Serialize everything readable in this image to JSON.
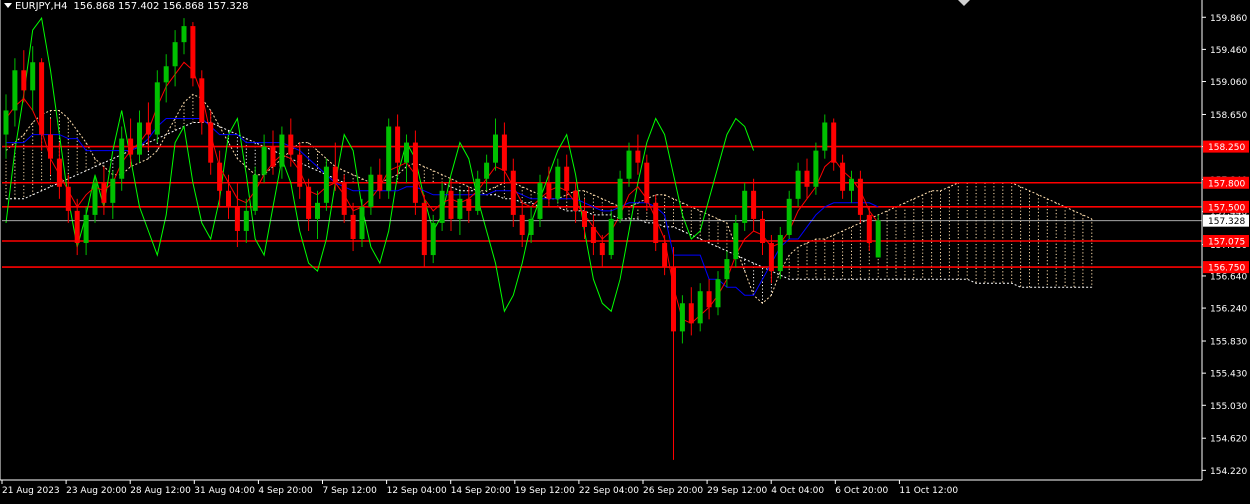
{
  "header": {
    "symbol": "EURJPY,H4",
    "ohlc": "156.868 157.402 156.868 157.328"
  },
  "colors": {
    "background": "#000000",
    "axis": "#ffffff",
    "bull": "#00c000",
    "bear": "#ff0000",
    "tenkan": "#ff0000",
    "kijun": "#0000ff",
    "chikou": "#00ff00",
    "cloud_up": "#ffdead",
    "cloud_down": "#ffffff",
    "level_line": "#ff0000",
    "level_label_bg": "#ff0000",
    "price_label_bg": "#ffffff"
  },
  "chart_data": {
    "type": "candlestick",
    "indicator": "ichimoku",
    "y_ticks": [
      "159.860",
      "159.460",
      "159.060",
      "158.650",
      "158.250",
      "157.840",
      "157.440",
      "157.030",
      "156.640",
      "156.240",
      "155.830",
      "155.430",
      "155.030",
      "154.620",
      "154.220"
    ],
    "x_ticks": [
      "21 Aug 2023",
      "23 Aug 20:00",
      "28 Aug 12:00",
      "31 Aug 04:00",
      "4 Sep 20:00",
      "7 Sep 12:00",
      "12 Sep 04:00",
      "14 Sep 20:00",
      "19 Sep 12:00",
      "22 Sep 04:00",
      "26 Sep 20:00",
      "29 Sep 12:00",
      "4 Oct 04:00",
      "6 Oct 20:00",
      "11 Oct 12:00"
    ],
    "ylim": [
      154.1,
      160.05
    ],
    "current_price": "157.328",
    "levels": [
      {
        "label": "158.250",
        "value": 158.25
      },
      {
        "label": "157.800",
        "value": 157.8
      },
      {
        "label": "157.500",
        "value": 157.5
      },
      {
        "label": "157.075",
        "value": 157.075
      },
      {
        "label": "156.750",
        "value": 156.75
      }
    ],
    "candles": [
      {
        "o": 158.4,
        "h": 158.9,
        "l": 158.1,
        "c": 158.7
      },
      {
        "o": 158.7,
        "h": 159.35,
        "l": 158.5,
        "c": 159.2
      },
      {
        "o": 159.2,
        "h": 159.45,
        "l": 158.8,
        "c": 158.95
      },
      {
        "o": 158.95,
        "h": 159.5,
        "l": 158.7,
        "c": 159.3
      },
      {
        "o": 159.3,
        "h": 159.35,
        "l": 158.2,
        "c": 158.4
      },
      {
        "o": 158.4,
        "h": 158.6,
        "l": 157.9,
        "c": 158.1
      },
      {
        "o": 158.1,
        "h": 158.3,
        "l": 157.6,
        "c": 157.75
      },
      {
        "o": 157.75,
        "h": 157.9,
        "l": 157.3,
        "c": 157.45
      },
      {
        "o": 157.45,
        "h": 157.6,
        "l": 156.9,
        "c": 157.05
      },
      {
        "o": 157.05,
        "h": 157.5,
        "l": 156.9,
        "c": 157.4
      },
      {
        "o": 157.4,
        "h": 157.9,
        "l": 157.3,
        "c": 157.8
      },
      {
        "o": 157.8,
        "h": 158.0,
        "l": 157.4,
        "c": 157.55
      },
      {
        "o": 157.55,
        "h": 157.95,
        "l": 157.35,
        "c": 157.85
      },
      {
        "o": 157.85,
        "h": 158.5,
        "l": 157.7,
        "c": 158.35
      },
      {
        "o": 158.35,
        "h": 158.6,
        "l": 158.0,
        "c": 158.15
      },
      {
        "o": 158.15,
        "h": 158.7,
        "l": 158.05,
        "c": 158.55
      },
      {
        "o": 158.55,
        "h": 158.8,
        "l": 158.2,
        "c": 158.4
      },
      {
        "o": 158.4,
        "h": 159.2,
        "l": 158.3,
        "c": 159.05
      },
      {
        "o": 159.05,
        "h": 159.4,
        "l": 158.8,
        "c": 159.25
      },
      {
        "o": 159.25,
        "h": 159.7,
        "l": 159.0,
        "c": 159.55
      },
      {
        "o": 159.55,
        "h": 159.85,
        "l": 159.4,
        "c": 159.75
      },
      {
        "o": 159.75,
        "h": 159.8,
        "l": 159.0,
        "c": 159.1
      },
      {
        "o": 159.1,
        "h": 159.2,
        "l": 158.4,
        "c": 158.55
      },
      {
        "o": 158.55,
        "h": 158.7,
        "l": 157.9,
        "c": 158.05
      },
      {
        "o": 158.05,
        "h": 158.2,
        "l": 157.5,
        "c": 157.7
      },
      {
        "o": 157.7,
        "h": 157.9,
        "l": 157.35,
        "c": 157.5
      },
      {
        "o": 157.5,
        "h": 157.8,
        "l": 157.0,
        "c": 157.2
      },
      {
        "o": 157.2,
        "h": 157.6,
        "l": 157.05,
        "c": 157.45
      },
      {
        "o": 157.45,
        "h": 158.0,
        "l": 157.4,
        "c": 157.9
      },
      {
        "o": 157.9,
        "h": 158.4,
        "l": 157.8,
        "c": 158.25
      },
      {
        "o": 158.25,
        "h": 158.45,
        "l": 157.9,
        "c": 158.0
      },
      {
        "o": 158.0,
        "h": 158.5,
        "l": 157.85,
        "c": 158.4
      },
      {
        "o": 158.4,
        "h": 158.6,
        "l": 158.0,
        "c": 158.15
      },
      {
        "o": 158.15,
        "h": 158.3,
        "l": 157.6,
        "c": 157.75
      },
      {
        "o": 157.75,
        "h": 157.85,
        "l": 157.2,
        "c": 157.35
      },
      {
        "o": 157.35,
        "h": 157.7,
        "l": 157.1,
        "c": 157.55
      },
      {
        "o": 157.55,
        "h": 158.1,
        "l": 157.45,
        "c": 158.0
      },
      {
        "o": 158.0,
        "h": 158.3,
        "l": 157.7,
        "c": 157.8
      },
      {
        "o": 157.8,
        "h": 157.9,
        "l": 157.3,
        "c": 157.4
      },
      {
        "o": 157.4,
        "h": 157.55,
        "l": 156.95,
        "c": 157.1
      },
      {
        "o": 157.1,
        "h": 157.6,
        "l": 157.0,
        "c": 157.5
      },
      {
        "o": 157.5,
        "h": 158.0,
        "l": 157.4,
        "c": 157.9
      },
      {
        "o": 157.9,
        "h": 158.1,
        "l": 157.6,
        "c": 157.7
      },
      {
        "o": 157.7,
        "h": 158.6,
        "l": 157.6,
        "c": 158.5
      },
      {
        "o": 158.5,
        "h": 158.65,
        "l": 157.9,
        "c": 158.05
      },
      {
        "o": 158.05,
        "h": 158.4,
        "l": 157.8,
        "c": 158.3
      },
      {
        "o": 158.3,
        "h": 158.45,
        "l": 157.4,
        "c": 157.55
      },
      {
        "o": 157.55,
        "h": 157.65,
        "l": 156.75,
        "c": 156.9
      },
      {
        "o": 156.9,
        "h": 157.4,
        "l": 156.8,
        "c": 157.3
      },
      {
        "o": 157.3,
        "h": 157.8,
        "l": 157.2,
        "c": 157.7
      },
      {
        "o": 157.7,
        "h": 157.85,
        "l": 157.2,
        "c": 157.35
      },
      {
        "o": 157.35,
        "h": 157.7,
        "l": 157.15,
        "c": 157.6
      },
      {
        "o": 157.6,
        "h": 157.75,
        "l": 157.3,
        "c": 157.45
      },
      {
        "o": 157.45,
        "h": 157.95,
        "l": 157.4,
        "c": 157.85
      },
      {
        "o": 157.85,
        "h": 158.15,
        "l": 157.7,
        "c": 158.05
      },
      {
        "o": 158.05,
        "h": 158.6,
        "l": 157.95,
        "c": 158.4
      },
      {
        "o": 158.4,
        "h": 158.55,
        "l": 157.8,
        "c": 157.95
      },
      {
        "o": 157.95,
        "h": 158.1,
        "l": 157.25,
        "c": 157.4
      },
      {
        "o": 157.4,
        "h": 157.55,
        "l": 157.0,
        "c": 157.15
      },
      {
        "o": 157.15,
        "h": 157.5,
        "l": 157.05,
        "c": 157.35
      },
      {
        "o": 157.35,
        "h": 157.9,
        "l": 157.25,
        "c": 157.8
      },
      {
        "o": 157.8,
        "h": 158.0,
        "l": 157.5,
        "c": 157.6
      },
      {
        "o": 157.6,
        "h": 158.1,
        "l": 157.55,
        "c": 158.0
      },
      {
        "o": 158.0,
        "h": 158.15,
        "l": 157.6,
        "c": 157.7
      },
      {
        "o": 157.7,
        "h": 157.8,
        "l": 157.3,
        "c": 157.45
      },
      {
        "o": 157.45,
        "h": 157.6,
        "l": 157.1,
        "c": 157.25
      },
      {
        "o": 157.25,
        "h": 157.4,
        "l": 156.9,
        "c": 157.05
      },
      {
        "o": 157.05,
        "h": 157.15,
        "l": 156.75,
        "c": 156.9
      },
      {
        "o": 156.9,
        "h": 157.45,
        "l": 156.85,
        "c": 157.35
      },
      {
        "o": 157.35,
        "h": 157.95,
        "l": 157.3,
        "c": 157.85
      },
      {
        "o": 157.85,
        "h": 158.3,
        "l": 157.75,
        "c": 158.2
      },
      {
        "o": 158.2,
        "h": 158.4,
        "l": 157.9,
        "c": 158.05
      },
      {
        "o": 158.05,
        "h": 158.15,
        "l": 157.45,
        "c": 157.55
      },
      {
        "o": 157.55,
        "h": 157.65,
        "l": 156.95,
        "c": 157.05
      },
      {
        "o": 157.05,
        "h": 157.15,
        "l": 156.65,
        "c": 156.75
      },
      {
        "o": 156.75,
        "h": 157.0,
        "l": 154.35,
        "c": 155.95
      },
      {
        "o": 155.95,
        "h": 156.4,
        "l": 155.8,
        "c": 156.3
      },
      {
        "o": 156.3,
        "h": 156.5,
        "l": 155.9,
        "c": 156.05
      },
      {
        "o": 156.05,
        "h": 156.55,
        "l": 155.95,
        "c": 156.45
      },
      {
        "o": 156.45,
        "h": 156.6,
        "l": 156.1,
        "c": 156.25
      },
      {
        "o": 156.25,
        "h": 156.7,
        "l": 156.15,
        "c": 156.6
      },
      {
        "o": 156.6,
        "h": 156.95,
        "l": 156.5,
        "c": 156.85
      },
      {
        "o": 156.85,
        "h": 157.4,
        "l": 156.75,
        "c": 157.3
      },
      {
        "o": 157.3,
        "h": 157.8,
        "l": 157.2,
        "c": 157.7
      },
      {
        "o": 157.7,
        "h": 157.85,
        "l": 157.2,
        "c": 157.35
      },
      {
        "o": 157.35,
        "h": 157.45,
        "l": 156.9,
        "c": 157.05
      },
      {
        "o": 157.05,
        "h": 157.15,
        "l": 156.55,
        "c": 156.7
      },
      {
        "o": 156.7,
        "h": 157.25,
        "l": 156.6,
        "c": 157.15
      },
      {
        "o": 157.15,
        "h": 157.7,
        "l": 157.1,
        "c": 157.6
      },
      {
        "o": 157.6,
        "h": 158.05,
        "l": 157.5,
        "c": 157.95
      },
      {
        "o": 157.95,
        "h": 158.1,
        "l": 157.6,
        "c": 157.75
      },
      {
        "o": 157.75,
        "h": 158.3,
        "l": 157.65,
        "c": 158.2
      },
      {
        "o": 158.2,
        "h": 158.65,
        "l": 158.1,
        "c": 158.55
      },
      {
        "o": 158.55,
        "h": 158.6,
        "l": 157.95,
        "c": 158.05
      },
      {
        "o": 158.05,
        "h": 158.15,
        "l": 157.6,
        "c": 157.7
      },
      {
        "o": 157.7,
        "h": 157.95,
        "l": 157.55,
        "c": 157.85
      },
      {
        "o": 157.85,
        "h": 157.95,
        "l": 157.3,
        "c": 157.4
      },
      {
        "o": 157.4,
        "h": 157.5,
        "l": 156.95,
        "c": 157.05
      },
      {
        "o": 156.87,
        "h": 157.4,
        "l": 156.87,
        "c": 157.33
      }
    ],
    "tenkan": [
      158.6,
      158.75,
      158.85,
      158.7,
      158.45,
      158.1,
      157.9,
      157.7,
      157.5,
      157.65,
      157.75,
      157.7,
      157.8,
      158.05,
      158.2,
      158.3,
      158.45,
      158.75,
      159.0,
      159.15,
      159.3,
      159.2,
      158.9,
      158.4,
      158.0,
      157.8,
      157.6,
      157.55,
      157.7,
      157.9,
      158.05,
      158.15,
      158.1,
      157.95,
      157.7,
      157.65,
      157.75,
      157.8,
      157.65,
      157.45,
      157.5,
      157.6,
      157.75,
      157.95,
      158.0,
      158.05,
      157.9,
      157.6,
      157.45,
      157.55,
      157.6,
      157.55,
      157.6,
      157.7,
      157.85,
      158.0,
      157.95,
      157.75,
      157.55,
      157.5,
      157.6,
      157.7,
      157.75,
      157.7,
      157.55,
      157.4,
      157.25,
      157.1,
      157.2,
      157.4,
      157.65,
      157.75,
      157.6,
      157.35,
      157.1,
      156.5,
      156.1,
      156.05,
      156.15,
      156.25,
      156.4,
      156.6,
      156.9,
      157.1,
      157.2,
      157.15,
      157.0,
      157.05,
      157.2,
      157.45,
      157.6,
      157.75,
      158.0,
      158.1,
      157.95,
      157.85,
      157.7,
      157.45,
      157.3
    ],
    "kijun": [
      158.3,
      158.3,
      158.3,
      158.4,
      158.4,
      158.4,
      158.4,
      158.35,
      158.35,
      158.2,
      158.2,
      158.2,
      158.2,
      158.2,
      158.2,
      158.25,
      158.35,
      158.5,
      158.6,
      158.6,
      158.6,
      158.6,
      158.6,
      158.5,
      158.4,
      158.4,
      158.4,
      158.3,
      158.3,
      158.3,
      158.3,
      158.3,
      158.25,
      158.2,
      158.1,
      158.0,
      157.9,
      157.8,
      157.75,
      157.7,
      157.7,
      157.7,
      157.7,
      157.7,
      157.7,
      157.75,
      157.75,
      157.7,
      157.65,
      157.65,
      157.65,
      157.65,
      157.65,
      157.65,
      157.65,
      157.7,
      157.7,
      157.7,
      157.65,
      157.6,
      157.6,
      157.6,
      157.6,
      157.6,
      157.6,
      157.55,
      157.5,
      157.45,
      157.45,
      157.5,
      157.55,
      157.55,
      157.55,
      157.5,
      157.4,
      156.9,
      156.9,
      156.9,
      156.9,
      156.6,
      156.6,
      156.5,
      156.5,
      156.4,
      156.4,
      156.6,
      156.8,
      157.0,
      157.1,
      157.1,
      157.25,
      157.4,
      157.5,
      157.55,
      157.55,
      157.55,
      157.55,
      157.55,
      157.5
    ],
    "chikou": [
      157.3,
      158.2,
      158.9,
      159.7,
      159.85,
      159.2,
      158.4,
      157.6,
      157.0,
      157.4,
      157.9,
      157.5,
      158.2,
      158.7,
      158.1,
      157.5,
      157.2,
      156.9,
      157.4,
      158.3,
      158.5,
      157.8,
      157.3,
      157.1,
      157.6,
      158.4,
      158.6,
      157.9,
      157.1,
      156.9,
      157.5,
      158.1,
      157.8,
      157.2,
      156.8,
      156.7,
      157.1,
      157.8,
      158.4,
      158.2,
      157.5,
      157.0,
      156.8,
      157.2,
      157.9,
      158.3,
      158.1,
      157.6,
      157.2,
      157.4,
      157.9,
      158.3,
      158.1,
      157.6,
      157.2,
      156.8,
      156.2,
      156.4,
      156.8,
      157.3,
      157.6,
      157.9,
      158.2,
      158.4,
      157.9,
      157.2,
      156.6,
      156.3,
      156.2,
      156.6,
      157.2,
      157.8,
      158.3,
      158.6,
      158.4,
      157.9,
      157.4,
      157.1,
      157.2,
      157.6,
      158.0,
      158.4,
      158.6,
      158.5,
      158.2
    ],
    "span_a": [
      158.2,
      158.3,
      158.4,
      158.55,
      158.65,
      158.7,
      158.7,
      158.6,
      158.45,
      158.3,
      158.1,
      158.0,
      157.9,
      157.9,
      158.0,
      158.05,
      158.1,
      158.2,
      158.4,
      158.6,
      158.8,
      158.9,
      158.85,
      158.7,
      158.5,
      158.3,
      158.1,
      158.0,
      157.9,
      157.9,
      158.0,
      158.1,
      158.2,
      158.3,
      158.3,
      158.2,
      158.1,
      158.0,
      157.95,
      157.9,
      157.85,
      157.8,
      157.8,
      157.85,
      157.9,
      158.0,
      158.05,
      158.0,
      157.95,
      157.9,
      157.85,
      157.8,
      157.75,
      157.7,
      157.7,
      157.75,
      157.8,
      157.8,
      157.75,
      157.7,
      157.65,
      157.6,
      157.6,
      157.65,
      157.7,
      157.7,
      157.65,
      157.6,
      157.55,
      157.5,
      157.5,
      157.55,
      157.6,
      157.65,
      157.65,
      157.6,
      157.55,
      157.5,
      157.45,
      157.4,
      157.35,
      157.3,
      157.0,
      156.7,
      156.4,
      156.3,
      156.4,
      156.7,
      156.9,
      157.0,
      157.05,
      157.1,
      157.1,
      157.15,
      157.2,
      157.25,
      157.3,
      157.35,
      157.4,
      157.45,
      157.5,
      157.55,
      157.6,
      157.65,
      157.7,
      157.7,
      157.75,
      157.8,
      157.8,
      157.8,
      157.8,
      157.8,
      157.8,
      157.8,
      157.75,
      157.7,
      157.65,
      157.6,
      157.55,
      157.5,
      157.45,
      157.4,
      157.35
    ],
    "span_b": [
      157.6,
      157.6,
      157.6,
      157.65,
      157.7,
      157.75,
      157.8,
      157.85,
      157.9,
      157.95,
      158.0,
      158.05,
      158.1,
      158.15,
      158.2,
      158.25,
      158.3,
      158.35,
      158.4,
      158.45,
      158.5,
      158.55,
      158.55,
      158.55,
      158.5,
      158.45,
      158.4,
      158.35,
      158.3,
      158.25,
      158.2,
      158.15,
      158.1,
      158.05,
      158.0,
      157.95,
      157.9,
      157.85,
      157.8,
      157.8,
      157.8,
      157.8,
      157.8,
      157.8,
      157.8,
      157.8,
      157.8,
      157.8,
      157.8,
      157.8,
      157.75,
      157.7,
      157.7,
      157.7,
      157.65,
      157.65,
      157.6,
      157.6,
      157.55,
      157.55,
      157.5,
      157.5,
      157.5,
      157.45,
      157.45,
      157.45,
      157.4,
      157.4,
      157.4,
      157.35,
      157.35,
      157.35,
      157.3,
      157.3,
      157.25,
      157.25,
      157.2,
      157.15,
      157.1,
      157.05,
      157.0,
      156.95,
      156.9,
      156.85,
      156.8,
      156.75,
      156.7,
      156.65,
      156.6,
      156.6,
      156.6,
      156.6,
      156.6,
      156.6,
      156.6,
      156.6,
      156.6,
      156.6,
      156.6,
      156.6,
      156.6,
      156.6,
      156.6,
      156.6,
      156.6,
      156.6,
      156.6,
      156.6,
      156.6,
      156.55,
      156.55,
      156.55,
      156.55,
      156.55,
      156.5,
      156.5,
      156.5,
      156.5,
      156.5,
      156.5,
      156.5,
      156.5,
      156.5
    ]
  }
}
